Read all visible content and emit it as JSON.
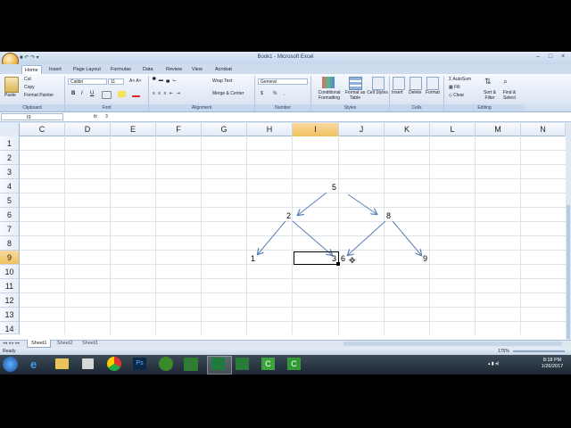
{
  "window": {
    "title": "Book1 - Microsoft Excel",
    "controls": [
      "–",
      "□",
      "×"
    ]
  },
  "tabs": [
    "Home",
    "Insert",
    "Page Layout",
    "Formulas",
    "Data",
    "Review",
    "View",
    "Acrobat"
  ],
  "ribbon": {
    "clipboard": {
      "paste": "Paste",
      "cut": "Cut",
      "copy": "Copy",
      "format_painter": "Format Painter",
      "label": "Clipboard"
    },
    "font": {
      "name": "Calibri",
      "size": "11",
      "bold": "B",
      "italic": "I",
      "underline": "U",
      "label": "Font"
    },
    "alignment": {
      "wrap": "Wrap Text",
      "merge": "Merge & Center",
      "label": "Alignment"
    },
    "number": {
      "format": "General",
      "currency": "$",
      "percent": "%",
      "comma": ",",
      "label": "Number"
    },
    "styles": {
      "conditional": "Conditional Formatting",
      "table": "Format as Table",
      "cell": "Cell Styles",
      "label": "Styles"
    },
    "cells": {
      "insert": "Insert",
      "delete": "Delete",
      "format": "Format",
      "label": "Cells"
    },
    "editing": {
      "autosum": "AutoSum",
      "fill": "Fill",
      "clear": "Clear",
      "sort": "Sort & Filter",
      "find": "Find & Select",
      "label": "Editing"
    }
  },
  "formula_bar": {
    "name_box": "I9",
    "fx": "fx",
    "formula": "3"
  },
  "columns": [
    "C",
    "D",
    "E",
    "F",
    "G",
    "H",
    "I",
    "J",
    "K",
    "L",
    "M",
    "N"
  ],
  "rows": [
    "1",
    "2",
    "3",
    "4",
    "5",
    "6",
    "7",
    "8",
    "9",
    "10",
    "11",
    "12",
    "13",
    "14"
  ],
  "selected": {
    "column": "I",
    "row": "9"
  },
  "cells": {
    "n5": "5",
    "n2": "2",
    "n8": "8",
    "n1": "1",
    "n3": "3",
    "n6": "6",
    "n9": "9"
  },
  "sheets": [
    "Sheet1",
    "Sheet2",
    "Sheet3"
  ],
  "status": {
    "ready": "Ready",
    "zoom": "175%"
  },
  "clock": {
    "time": "8:18 PM",
    "date": "1/26/2017"
  }
}
